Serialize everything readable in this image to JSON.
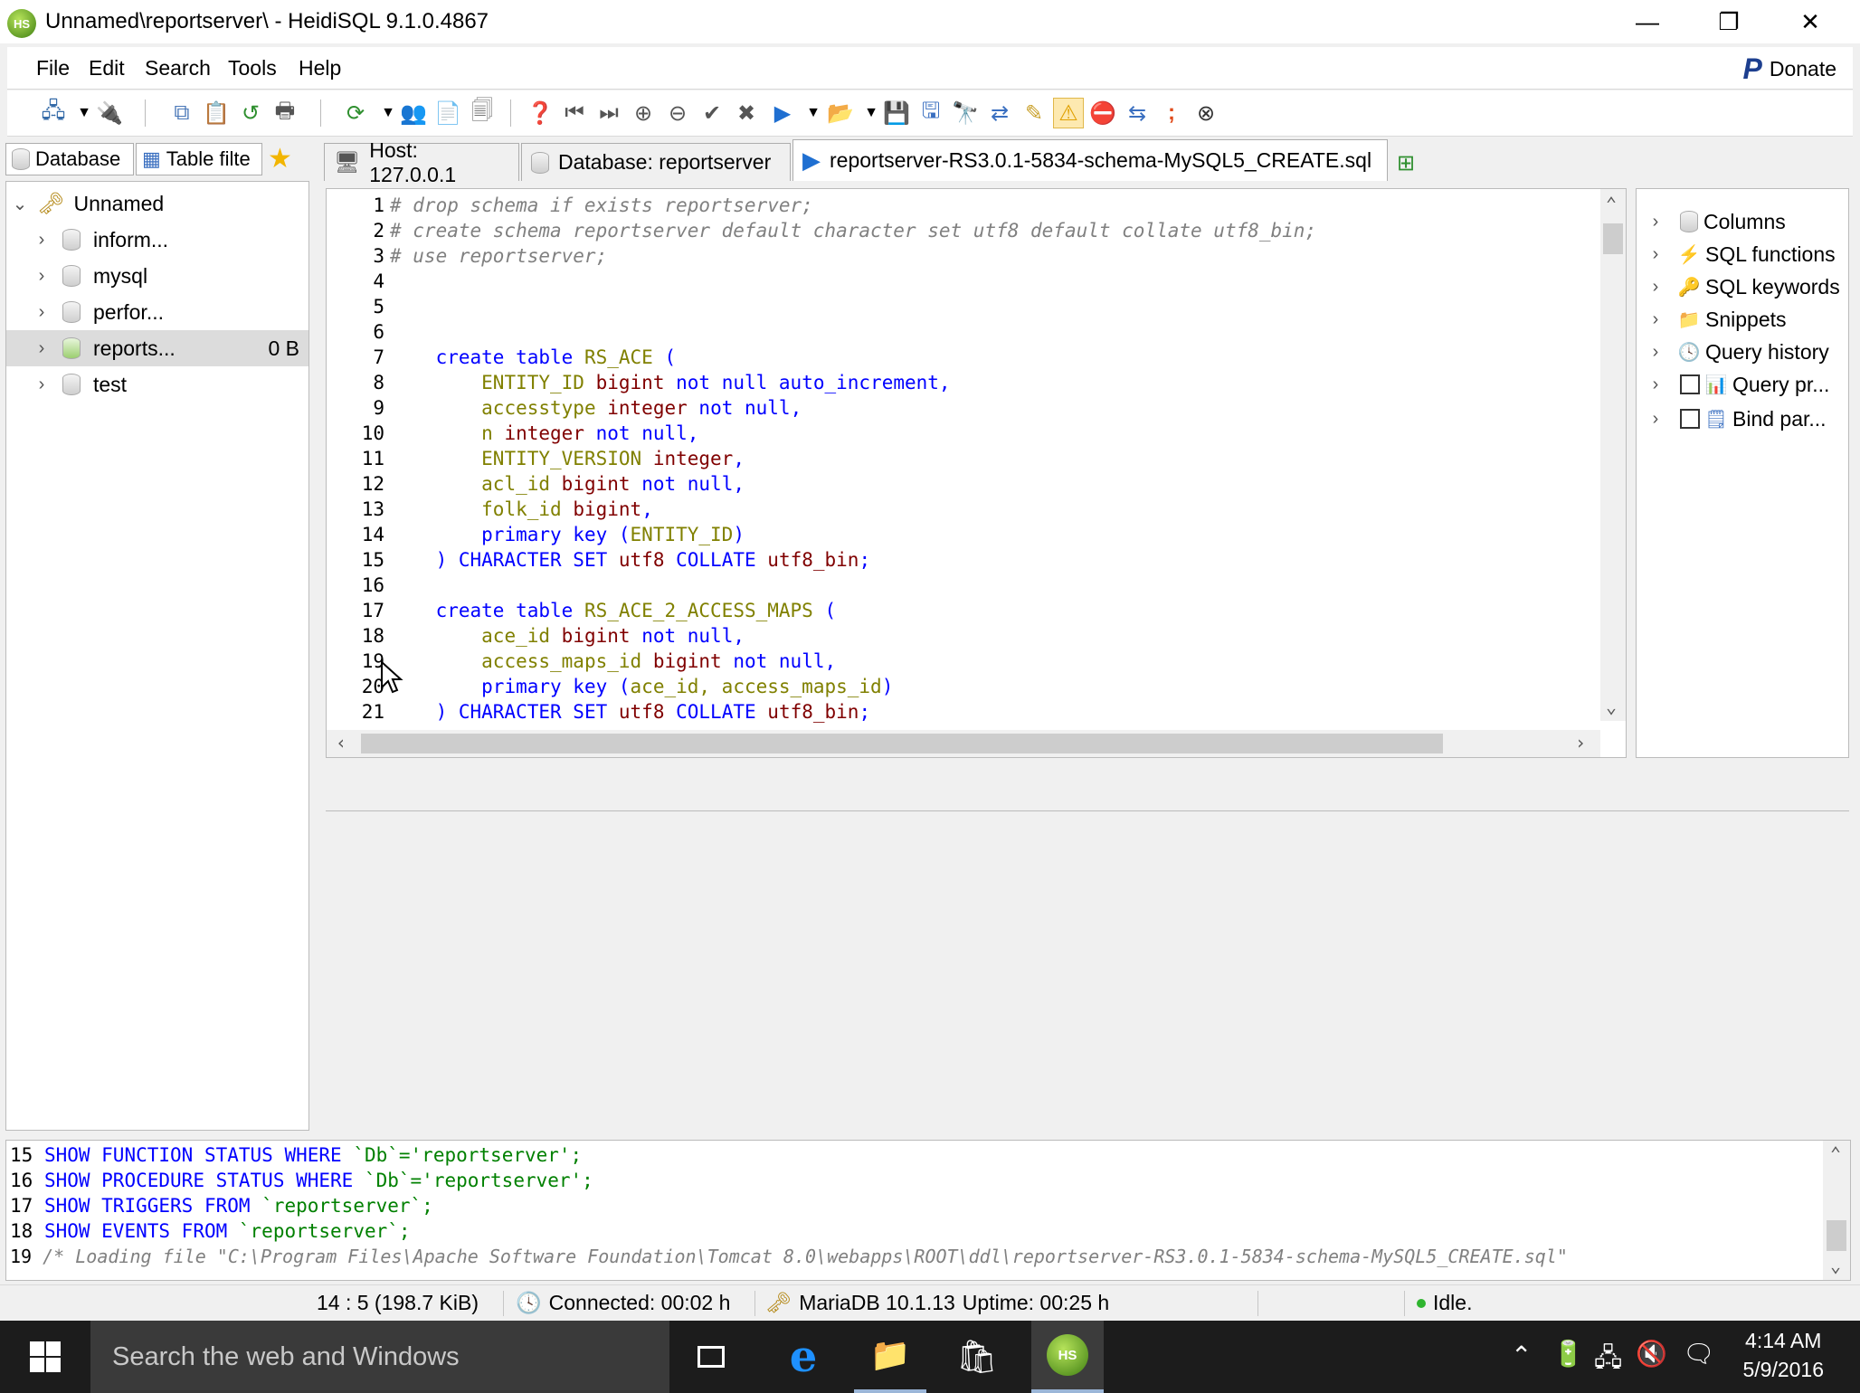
{
  "window": {
    "title": "Unnamed\\reportserver\\ - HeidiSQL 9.1.0.4867",
    "app_icon_text": "HS",
    "minimize": "—",
    "maximize": "❐",
    "close": "✕"
  },
  "menu": {
    "items": [
      "File",
      "Edit",
      "Search",
      "Tools",
      "Help"
    ],
    "donate_label": "Donate",
    "donate_glyph": "P"
  },
  "left_tabs": {
    "database": "Database",
    "table_filter": "Table filte"
  },
  "tree": {
    "root": "Unnamed",
    "databases": [
      {
        "name": "inform...",
        "size": ""
      },
      {
        "name": "mysql",
        "size": ""
      },
      {
        "name": "perfor...",
        "size": ""
      },
      {
        "name": "reports...",
        "size": "0 B"
      },
      {
        "name": "test",
        "size": ""
      }
    ]
  },
  "main_tabs": {
    "host": "Host: 127.0.0.1",
    "database": "Database: reportserver",
    "query": "reportserver-RS3.0.1-5834-schema-MySQL5_CREATE.sql"
  },
  "editor": {
    "line_numbers": [
      "1",
      "2",
      "3",
      "4",
      "5",
      "6",
      "7",
      "8",
      "9",
      "10",
      "11",
      "12",
      "13",
      "14",
      "15",
      "16",
      "17",
      "18",
      "19",
      "20",
      "21"
    ]
  },
  "helpers": {
    "items": [
      "Columns",
      "SQL functions",
      "SQL keywords",
      "Snippets",
      "Query history",
      "Query pr...",
      "Bind par..."
    ]
  },
  "log": {
    "lines": [
      {
        "n": "15",
        "kw": "SHOW FUNCTION STATUS WHERE ",
        "rest": "`Db`='reportserver';"
      },
      {
        "n": "16",
        "kw": "SHOW PROCEDURE STATUS WHERE ",
        "rest": "`Db`='reportserver';"
      },
      {
        "n": "17",
        "kw": "SHOW TRIGGERS FROM ",
        "rest": "`reportserver`;"
      },
      {
        "n": "18",
        "kw": "SHOW EVENTS FROM ",
        "rest": "`reportserver`;"
      },
      {
        "n": "19",
        "comment": "/* Loading file \"C:\\Program Files\\Apache Software Foundation\\Tomcat 8.0\\webapps\\ROOT\\ddl\\reportserver-RS3.0.1-5834-schema-MySQL5_CREATE.sql\""
      }
    ]
  },
  "status": {
    "position": "14 : 5 (198.7 KiB)",
    "connected": "Connected: 00:02 h",
    "server": "MariaDB 10.1.13",
    "uptime": "Uptime: 00:25 h",
    "state": "Idle."
  },
  "taskbar": {
    "search_placeholder": "Search the web and Windows",
    "time": "4:14 AM",
    "date": "5/9/2016"
  }
}
